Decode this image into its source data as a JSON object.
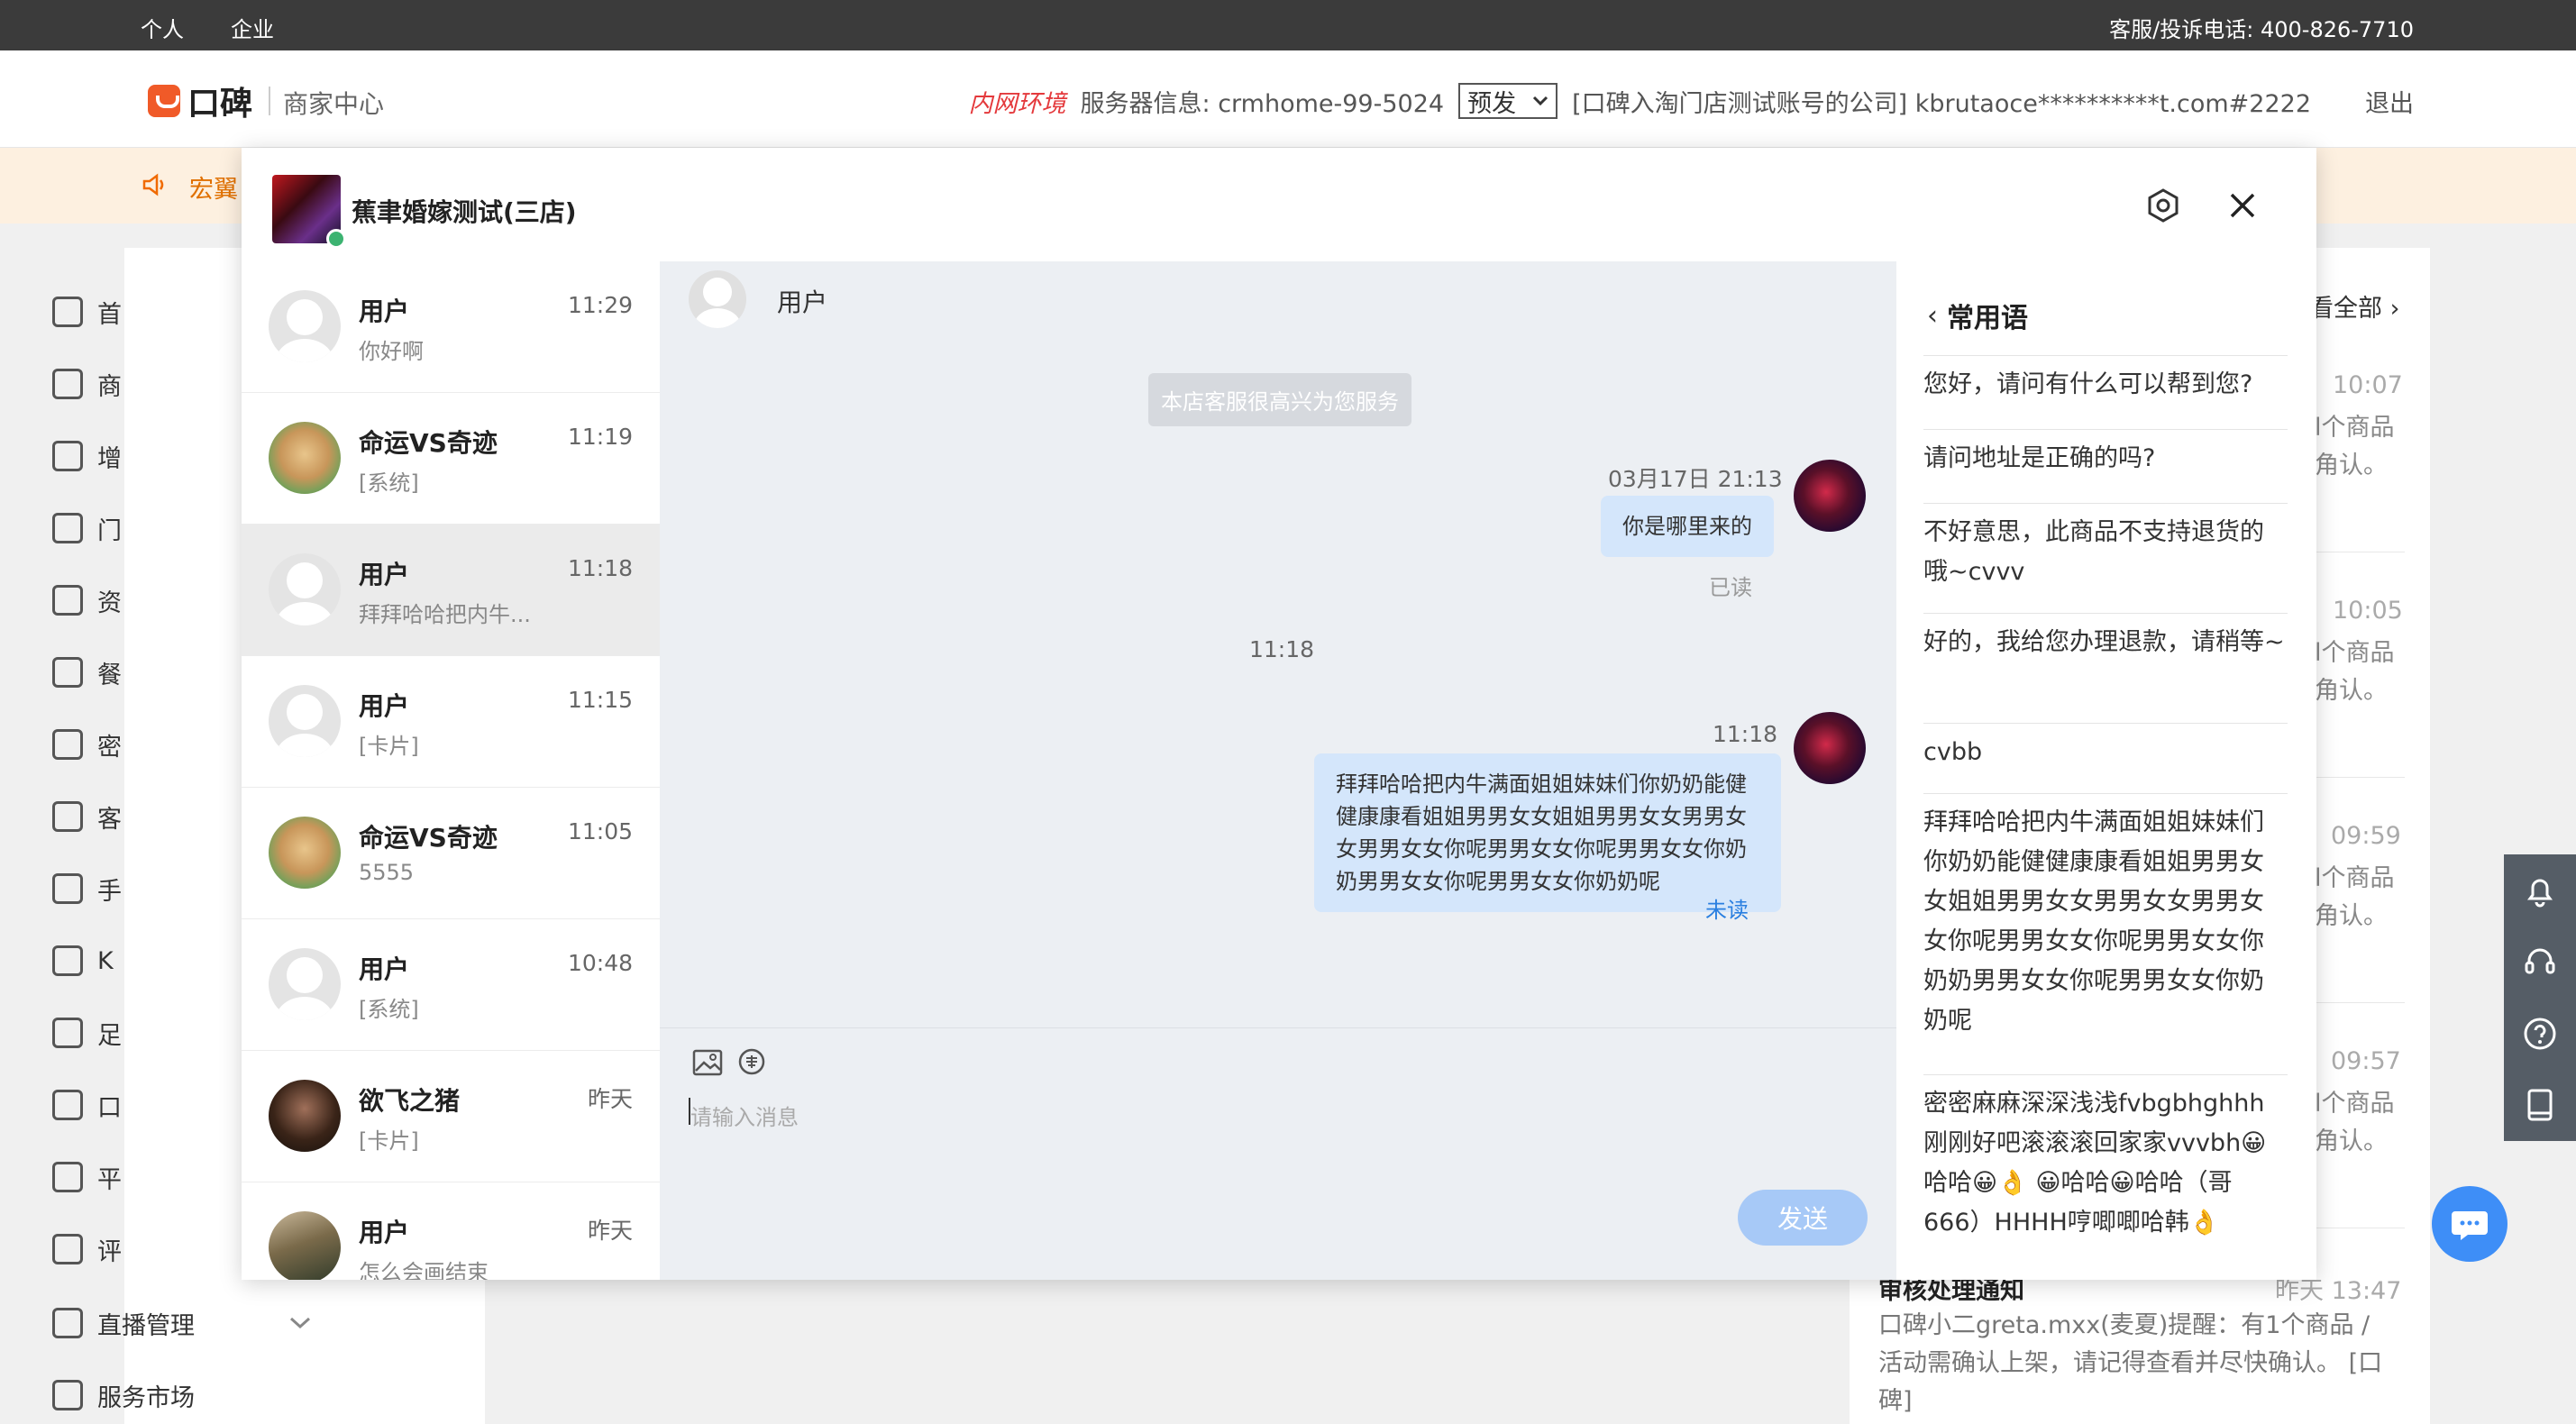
{
  "topbar": {
    "tab_personal": "个人",
    "tab_enterprise": "企业",
    "hotline": "客服/投诉电话: 400-826-7710"
  },
  "header": {
    "logo_text": "口碑",
    "logo_sub": "商家中心",
    "env": "内网环境",
    "server": "服务器信息: crmhome-99-5024",
    "select_value": "预发",
    "account": "[口碑入淘门店测试账号的公司]  kbrutaoce**********t.com#2222",
    "logout": "退出"
  },
  "notice": {
    "text": "宏翼"
  },
  "sidemenu": {
    "items": [
      "首",
      "商",
      "增",
      "门",
      "资",
      "餐",
      "密",
      "客",
      "手",
      "K",
      "足",
      "口",
      "平",
      "评"
    ],
    "live": "直播管理",
    "market": "服务市场"
  },
  "rightpanel": {
    "view_all": "看全部",
    "times": [
      "10:07",
      "10:05",
      "09:59",
      "09:57"
    ],
    "frag_goods": "l个商品",
    "frag_confirm": "角认。",
    "bottom_title": "审核处理通知",
    "bottom_time": "昨天 13:47",
    "bottom_body": "口碑小二greta.mxx(麦夏)提醒：有1个商品 / 活动需确认上架，请记得查看并尽快确认。 [口碑]"
  },
  "modal": {
    "shop_name": "蕉聿婚嫁测试(三店)"
  },
  "conversations": [
    {
      "name": "用户",
      "time": "11:29",
      "msg": "你好啊",
      "avatar": "default"
    },
    {
      "name": "命运VS奇迹",
      "time": "11:19",
      "msg": "[系统]",
      "avatar": "dog"
    },
    {
      "name": "用户",
      "time": "11:18",
      "msg": "拜拜哈哈把内牛...",
      "avatar": "default"
    },
    {
      "name": "用户",
      "time": "11:15",
      "msg": "[卡片]",
      "avatar": "default"
    },
    {
      "name": "命运VS奇迹",
      "time": "11:05",
      "msg": "5555",
      "avatar": "dog"
    },
    {
      "name": "用户",
      "time": "10:48",
      "msg": "[系统]",
      "avatar": "default"
    },
    {
      "name": "欲飞之猪",
      "time": "昨天",
      "msg": "[卡片]",
      "avatar": "hair"
    },
    {
      "name": "用户",
      "time": "昨天",
      "msg": "怎么会画结束",
      "avatar": "people"
    }
  ],
  "chat": {
    "peer_name": "用户",
    "system_notice": "本店客服很高兴为您服务",
    "msg1_time": "03月17日 21:13",
    "msg1_text": "你是哪里来的",
    "msg1_status": "已读",
    "divider_time": "11:18",
    "msg2_time": "11:18",
    "msg2_text": "拜拜哈哈把内牛满面姐姐妹妹们你奶奶能健健康康看姐姐男男女女姐姐男男女女男男女女男男女女你呢男男女女你呢男男女女你奶奶男男女女你呢男男女女你奶奶呢",
    "msg2_status": "未读",
    "input_placeholder": "请输入消息",
    "send": "发送"
  },
  "phrases": {
    "title": "常用语",
    "items": [
      "您好，请问有什么可以帮到您?",
      "请问地址是正确的吗?",
      "不好意思，此商品不支持退货的哦~cvvv",
      "好的，我给您办理退款，请稍等~",
      "cvbb",
      "拜拜哈哈把内牛满面姐姐妹妹们你奶奶能健健康康看姐姐男男女女姐姐男男女女男男女女男男女女你呢男男女女你呢男男女女你奶奶男男女女你呢男男女女你奶奶呢",
      "密密麻麻深深浅浅fvbgbhghhh刚刚好吧滚滚滚回家家vvvbh😀哈哈😀👌 😀哈哈😀哈哈（哥666）HHHH哼唧唧哈韩👌"
    ]
  },
  "colors": {
    "topbar": "#3b3b3b",
    "brand": "#f05a28",
    "env_red": "#e4393c",
    "bubble": "#d4e6fb",
    "send_button": "#a7c9f7",
    "unread_blue": "#2a7fe0",
    "online_green": "#3cb371"
  }
}
